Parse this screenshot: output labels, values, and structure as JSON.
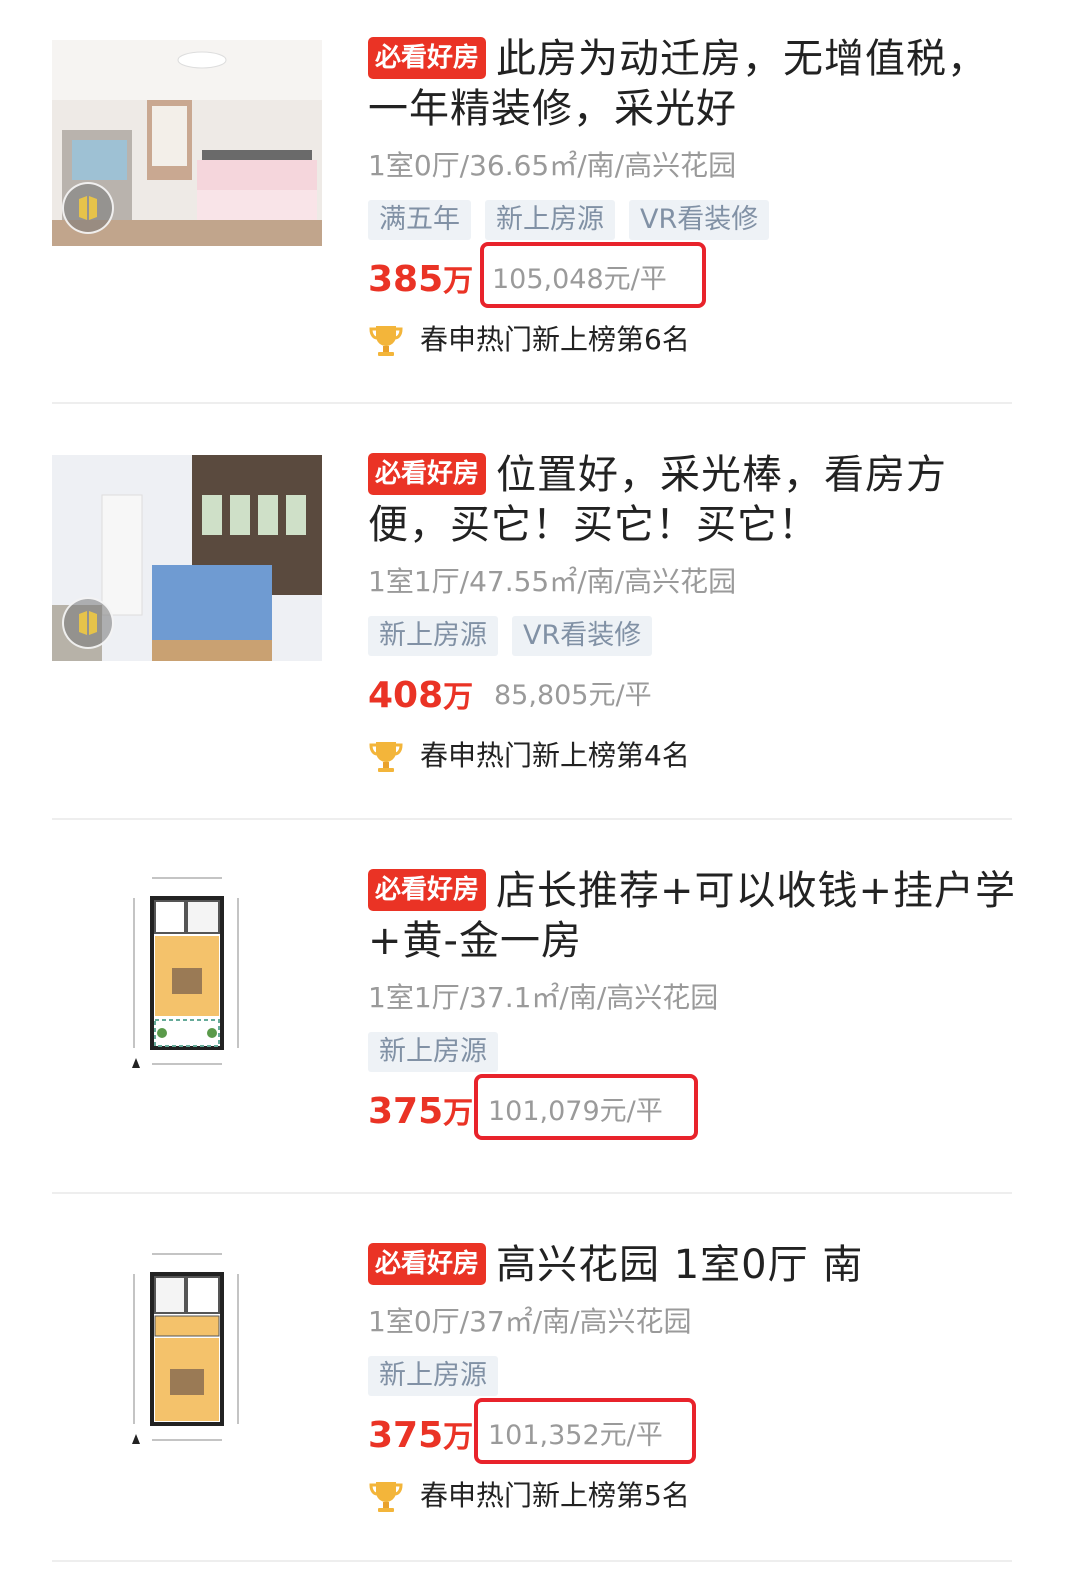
{
  "listings": [
    {
      "badge": "必看好房",
      "title": "此房为动迁房，无增值税，一年精装修，采光好",
      "meta": "1室0厅/36.65㎡/南/高兴花园",
      "tags": [
        "满五年",
        "新上房源",
        "VR看装修"
      ],
      "total_price": "385",
      "total_unit": "万",
      "unit_price": "105,048元/平",
      "unit_price_highlighted": true,
      "rank": "春申热门新上榜第6名",
      "has_vr": true,
      "thumb_type": "photo"
    },
    {
      "badge": "必看好房",
      "title": "位置好，采光棒，看房方便，买它！买它！买它！",
      "meta": "1室1厅/47.55㎡/南/高兴花园",
      "tags": [
        "新上房源",
        "VR看装修"
      ],
      "total_price": "408",
      "total_unit": "万",
      "unit_price": "85,805元/平",
      "unit_price_highlighted": false,
      "rank": "春申热门新上榜第4名",
      "has_vr": true,
      "thumb_type": "photo"
    },
    {
      "badge": "必看好房",
      "title": "店长推荐+可以收钱+挂户学+黄-金一房",
      "meta": "1室1厅/37.1㎡/南/高兴花园",
      "tags": [
        "新上房源"
      ],
      "total_price": "375",
      "total_unit": "万",
      "unit_price": "101,079元/平",
      "unit_price_highlighted": true,
      "rank": "",
      "has_vr": false,
      "thumb_type": "floorplan"
    },
    {
      "badge": "必看好房",
      "title": "高兴花园 1室0厅 南",
      "meta": "1室0厅/37㎡/南/高兴花园",
      "tags": [
        "新上房源"
      ],
      "total_price": "375",
      "total_unit": "万",
      "unit_price": "101,352元/平",
      "unit_price_highlighted": true,
      "rank": "春申热门新上榜第5名",
      "has_vr": false,
      "thumb_type": "floorplan"
    }
  ],
  "colors": {
    "accent_red": "#ea3325",
    "highlight_box": "#e8232b",
    "tag_bg": "#eef2f6",
    "tag_text": "#8191a5",
    "muted_text": "#9a9a9a"
  }
}
